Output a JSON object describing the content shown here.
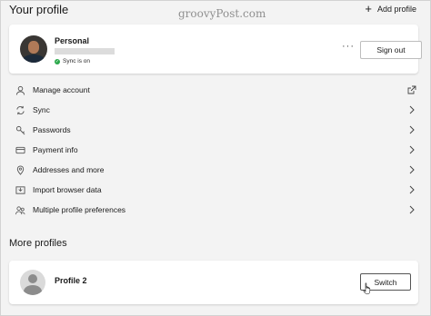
{
  "header": {
    "title": "Your profile",
    "watermark": "groovyPost.com",
    "add_profile_label": "Add profile"
  },
  "current_profile": {
    "name": "Personal",
    "sync_status": "Sync is on",
    "sign_out_label": "Sign out",
    "more_actions": "···"
  },
  "menu": [
    {
      "label": "Manage account",
      "icon": "person-icon",
      "trailing": "external-link-icon"
    },
    {
      "label": "Sync",
      "icon": "sync-icon",
      "trailing": "chevron-right-icon"
    },
    {
      "label": "Passwords",
      "icon": "key-icon",
      "trailing": "chevron-right-icon"
    },
    {
      "label": "Payment info",
      "icon": "credit-card-icon",
      "trailing": "chevron-right-icon"
    },
    {
      "label": "Addresses and more",
      "icon": "location-pin-icon",
      "trailing": "chevron-right-icon"
    },
    {
      "label": "Import browser data",
      "icon": "import-icon",
      "trailing": "chevron-right-icon"
    },
    {
      "label": "Multiple profile preferences",
      "icon": "people-icon",
      "trailing": "chevron-right-icon"
    }
  ],
  "more_profiles": {
    "title": "More profiles",
    "profiles": [
      {
        "name": "Profile 2",
        "switch_label": "Switch"
      }
    ]
  },
  "colors": {
    "background": "#f3f3f3",
    "card": "#ffffff",
    "sync_ok": "#2aa84a"
  }
}
